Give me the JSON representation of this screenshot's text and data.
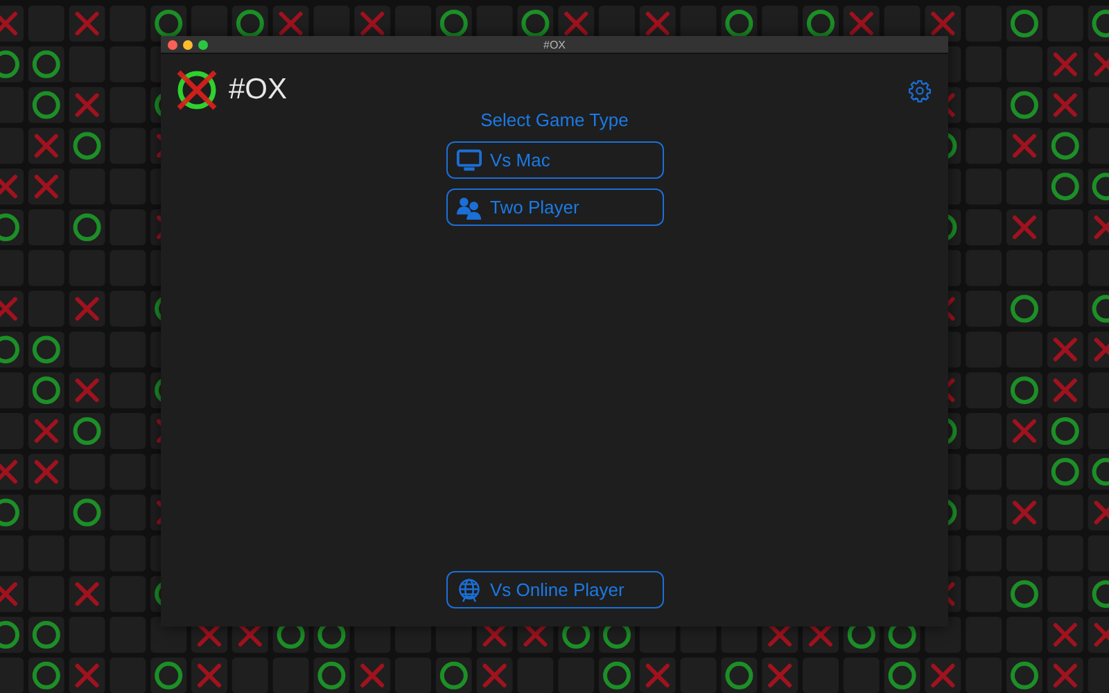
{
  "window": {
    "title": "#OX"
  },
  "app_title": "#OX",
  "heading": "Select Game Type",
  "game_types": [
    {
      "label": "Vs Mac",
      "kind": "computer"
    },
    {
      "label": "Two Player",
      "kind": "people"
    }
  ],
  "online_button": {
    "label": "Vs Online Player",
    "kind": "globe"
  }
}
